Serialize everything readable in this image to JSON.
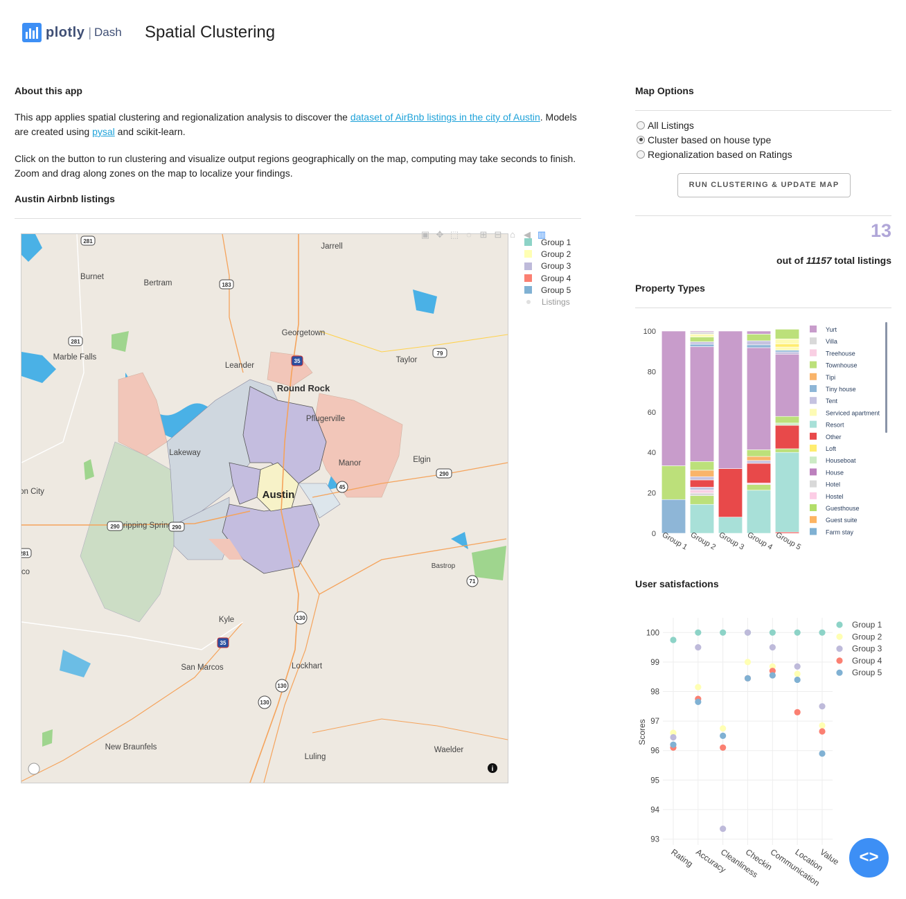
{
  "header": {
    "brand": "plotly",
    "brand_suffix": "Dash",
    "title": "Spatial Clustering"
  },
  "about": {
    "heading": "About this app",
    "p1_before": "This app applies spatial clustering and regionalization analysis to discover the ",
    "p1_link": "dataset of AirBnb listings in the city of Austin",
    "p1_mid": ". Models are created using ",
    "p1_link2": "pysal",
    "p1_after": " and scikit-learn.",
    "p2": "Click on the button to run clustering and visualize output regions geographically on the map, computing may take seconds to finish. Zoom and drag along zones on the map to localize your findings.",
    "map_heading": "Austin Airbnb listings"
  },
  "map": {
    "legend": [
      {
        "label": "Group 1",
        "color": "#8dd3c7"
      },
      {
        "label": "Group 2",
        "color": "#ffffb3"
      },
      {
        "label": "Group 3",
        "color": "#bebada"
      },
      {
        "label": "Group 4",
        "color": "#fb8072"
      },
      {
        "label": "Group 5",
        "color": "#80b1d3"
      },
      {
        "label": "Listings",
        "color": "#e0e0e0"
      }
    ],
    "places": [
      "Jarrell",
      "Burnet",
      "Bertram",
      "Georgetown",
      "Marble Falls",
      "Leander",
      "Round Rock",
      "Taylor",
      "Pflugerville",
      "Lakeway",
      "Manor",
      "Elgin",
      "Austin",
      "Dripping Springs",
      "Kyle",
      "San Marcos",
      "Lockhart",
      "Bastrop",
      "New Braunfels",
      "Luling",
      "Waelder",
      "on City",
      "co"
    ],
    "shields": [
      "281",
      "183",
      "281",
      "35",
      "79",
      "290",
      "290",
      "290",
      "45",
      "281",
      "71",
      "130",
      "35",
      "130",
      "130"
    ]
  },
  "options": {
    "heading": "Map Options",
    "radios": [
      {
        "label": "All Listings",
        "selected": false
      },
      {
        "label": "Cluster based on house type",
        "selected": true
      },
      {
        "label": "Regionalization based on Ratings",
        "selected": false
      }
    ],
    "button": "RUN CLUSTERING & UPDATE MAP",
    "count": "13",
    "count_prefix": "out of",
    "total": "11157",
    "count_suffix": "total listings"
  },
  "property": {
    "heading": "Property Types",
    "chart_data": {
      "type": "bar",
      "stacked": true,
      "categories": [
        "Group 1",
        "Group 2",
        "Group 3",
        "Group 4",
        "Group 5"
      ],
      "ylim": [
        0,
        100
      ],
      "yticks": [
        0,
        20,
        40,
        60,
        80,
        100
      ],
      "series": [
        {
          "name": "Farm stay",
          "color": "#80b1d3",
          "values": [
            16.7,
            0,
            0,
            0,
            0
          ]
        },
        {
          "name": "Guest suite",
          "color": "#fdb462",
          "values": [
            0,
            0,
            0,
            0,
            0
          ]
        },
        {
          "name": "Guesthouse",
          "color": "#b3de69",
          "values": [
            16.7,
            4.3,
            0,
            2.8,
            0
          ]
        },
        {
          "name": "Hostel",
          "color": "#fccde5",
          "values": [
            0,
            0,
            0,
            0,
            0
          ]
        },
        {
          "name": "Hotel",
          "color": "#d9d9d9",
          "values": [
            0,
            0,
            0,
            0,
            0
          ]
        },
        {
          "name": "House",
          "color": "#bc80bd",
          "values": [
            0,
            0,
            0,
            0,
            0
          ]
        },
        {
          "name": "Houseboat",
          "color": "#ccebc5",
          "values": [
            0,
            0,
            0,
            0,
            0
          ]
        },
        {
          "name": "Loft",
          "color": "#ffed6f",
          "values": [
            0,
            0,
            0,
            0,
            0
          ]
        },
        {
          "name": "Other",
          "color": "#e8494a",
          "values": [
            0,
            0,
            0,
            0,
            0
          ]
        },
        {
          "name": "Resort",
          "color": "#a8e0d8",
          "values": [
            0,
            14.3,
            8,
            21.3,
            40
          ]
        },
        {
          "name": "Serviced apartment",
          "color": "#fdfbb5",
          "values": [
            0,
            0,
            0,
            0,
            0
          ]
        },
        {
          "name": "Tent",
          "color": "#c5c2e0",
          "values": [
            0,
            1.5,
            0,
            0,
            0
          ]
        },
        {
          "name": "Tiny house",
          "color": "#8eb6d7",
          "values": [
            0,
            0,
            0,
            0,
            0
          ]
        },
        {
          "name": "Tipi",
          "color": "#f9b46a",
          "values": [
            0,
            0,
            0,
            0,
            0
          ]
        },
        {
          "name": "Townhouse",
          "color": "#bce07a",
          "values": [
            0,
            0,
            0,
            0,
            0
          ]
        },
        {
          "name": "Treehouse",
          "color": "#f9cfe3",
          "values": [
            0,
            0,
            0,
            0,
            0
          ]
        },
        {
          "name": "Villa",
          "color": "#d9d9d9",
          "values": [
            0,
            0,
            0,
            0,
            0
          ]
        },
        {
          "name": "Yurt",
          "color": "#c89ccb",
          "values": [
            0,
            0,
            0,
            0,
            0
          ]
        }
      ],
      "stacks": [
        [
          [
            16.7,
            "#8eb6d7"
          ],
          [
            16.7,
            "#bce07a"
          ],
          [
            66.6,
            "#c89ccb"
          ]
        ],
        [
          [
            14.3,
            "#a8e0d8"
          ],
          [
            4.3,
            "#bce07a"
          ],
          [
            1.3,
            "#d9d9d9"
          ],
          [
            1.5,
            "#f9cfe3"
          ],
          [
            1.4,
            "#c5c2e0"
          ],
          [
            3.6,
            "#e8494a"
          ],
          [
            1.6,
            "#c5c2e0"
          ],
          [
            3.2,
            "#f9b46a"
          ],
          [
            4.3,
            "#bce07a"
          ],
          [
            56.8,
            "#c89ccb"
          ],
          [
            1.2,
            "#8eb6d7"
          ],
          [
            1.2,
            "#c5c2e0"
          ],
          [
            2.4,
            "#bce07a"
          ],
          [
            1.4,
            "#fdfbb5"
          ],
          [
            1.0,
            "#d9d9d9"
          ],
          [
            0.5,
            "#c89ccb"
          ]
        ],
        [
          [
            8,
            "#a8e0d8"
          ],
          [
            24,
            "#e8494a"
          ],
          [
            68,
            "#c89ccb"
          ]
        ],
        [
          [
            21.3,
            "#a8e0d8"
          ],
          [
            2.8,
            "#bce07a"
          ],
          [
            0.8,
            "#f9cfe3"
          ],
          [
            9.7,
            "#e8494a"
          ],
          [
            1.4,
            "#c5c2e0"
          ],
          [
            2.0,
            "#f9b46a"
          ],
          [
            3.3,
            "#bce07a"
          ],
          [
            50.5,
            "#c89ccb"
          ],
          [
            1.4,
            "#8eb6d7"
          ],
          [
            2.0,
            "#c5c2e0"
          ],
          [
            3.3,
            "#bce07a"
          ],
          [
            1.5,
            "#c89ccb"
          ]
        ],
        [
          [
            0.6,
            "#e8494a"
          ],
          [
            39.4,
            "#a8e0d8"
          ],
          [
            1.8,
            "#bce07a"
          ],
          [
            11.6,
            "#e8494a"
          ],
          [
            1.1,
            "#ccebc5"
          ],
          [
            3.3,
            "#bce07a"
          ],
          [
            30.8,
            "#c89ccb"
          ],
          [
            1.1,
            "#c5c2e0"
          ],
          [
            0.8,
            "#8eb6d7"
          ],
          [
            1.6,
            "#fdfbb5"
          ],
          [
            1.6,
            "#ffed6f"
          ],
          [
            2.4,
            "#fdfbb5"
          ],
          [
            4.8,
            "#bce07a"
          ]
        ]
      ],
      "legend": [
        {
          "name": "Yurt",
          "color": "#c89ccb"
        },
        {
          "name": "Villa",
          "color": "#d9d9d9"
        },
        {
          "name": "Treehouse",
          "color": "#f9cfe3"
        },
        {
          "name": "Townhouse",
          "color": "#bce07a"
        },
        {
          "name": "Tipi",
          "color": "#f9b46a"
        },
        {
          "name": "Tiny house",
          "color": "#8eb6d7"
        },
        {
          "name": "Tent",
          "color": "#c5c2e0"
        },
        {
          "name": "Serviced apartment",
          "color": "#fdfbb5"
        },
        {
          "name": "Resort",
          "color": "#a8e0d8"
        },
        {
          "name": "Other",
          "color": "#e8494a"
        },
        {
          "name": "Loft",
          "color": "#ffed6f"
        },
        {
          "name": "Houseboat",
          "color": "#ccebc5"
        },
        {
          "name": "House",
          "color": "#bc80bd"
        },
        {
          "name": "Hotel",
          "color": "#d9d9d9"
        },
        {
          "name": "Hostel",
          "color": "#fccde5"
        },
        {
          "name": "Guesthouse",
          "color": "#b3de69"
        },
        {
          "name": "Guest suite",
          "color": "#fdb462"
        },
        {
          "name": "Farm stay",
          "color": "#80b1d3"
        }
      ]
    }
  },
  "satisfaction": {
    "heading": "User satisfactions",
    "chart_data": {
      "type": "scatter",
      "ylabel": "Scores",
      "ylim": [
        92.8,
        100.5
      ],
      "yticks": [
        93,
        94,
        95,
        96,
        97,
        98,
        99,
        100
      ],
      "categories": [
        "Rating",
        "Accuracy",
        "Cleanliness",
        "Checkin",
        "Communication",
        "Location",
        "Value"
      ],
      "series": [
        {
          "name": "Group 1",
          "color": "#8dd3c7",
          "values": [
            99.75,
            100,
            100,
            100,
            100,
            100,
            100
          ]
        },
        {
          "name": "Group 2",
          "color": "#ffffb3",
          "values": [
            96.6,
            98.15,
            96.75,
            99.0,
            98.85,
            98.6,
            96.85
          ]
        },
        {
          "name": "Group 3",
          "color": "#bebada",
          "values": [
            96.45,
            99.5,
            93.35,
            100,
            99.5,
            98.85,
            97.5
          ]
        },
        {
          "name": "Group 4",
          "color": "#fb8072",
          "values": [
            96.1,
            97.75,
            96.1,
            98.45,
            98.7,
            97.3,
            96.65
          ]
        },
        {
          "name": "Group 5",
          "color": "#80b1d3",
          "values": [
            96.2,
            97.65,
            96.5,
            98.45,
            98.55,
            98.4,
            95.9
          ]
        }
      ]
    }
  }
}
